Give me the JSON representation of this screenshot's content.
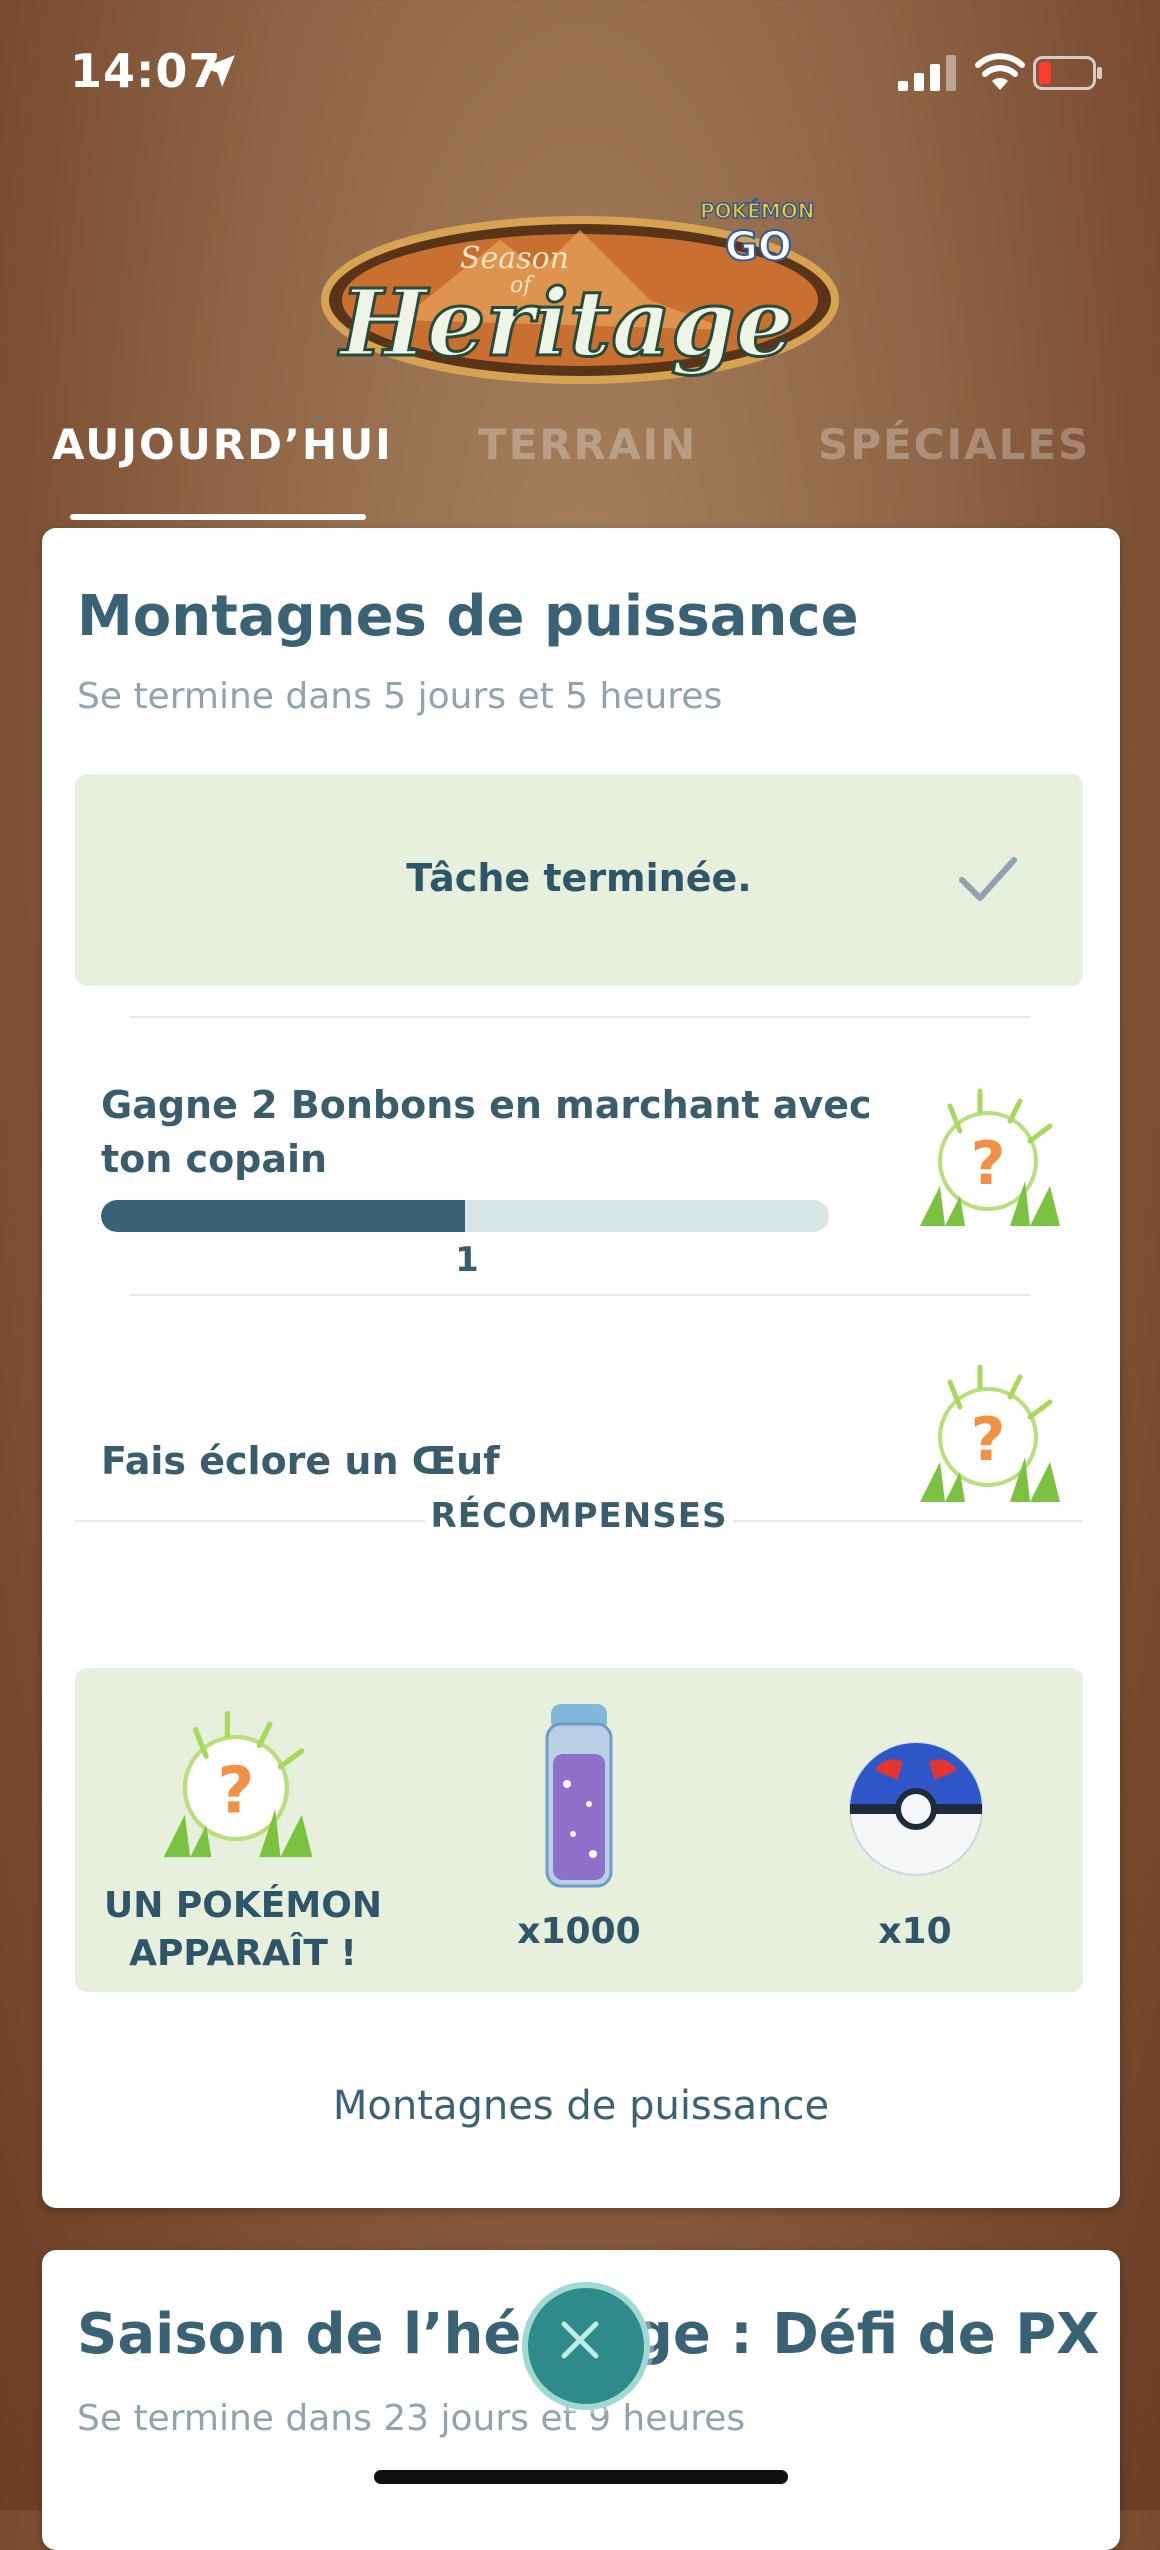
{
  "status_bar": {
    "time": "14:07"
  },
  "logo": {
    "line1": "Season",
    "line2": "of",
    "line3": "Heritage",
    "brand1": "POKÉMON",
    "brand2": "GO"
  },
  "tabs": [
    {
      "label": "AUJOURD’HUI",
      "active": true
    },
    {
      "label": "TERRAIN",
      "active": false
    },
    {
      "label": "SPÉCIALES",
      "active": false
    }
  ],
  "research": {
    "title": "Montagnes de puissance",
    "subtitle": "Se termine dans 5 jours et 5 heures",
    "completed_task": "Tâche terminée.",
    "tasks": [
      {
        "text_line1": "Gagne 2 Bonbons en marchant avec",
        "text_line2": "ton copain",
        "progress": 0.5,
        "progress_label": "1"
      },
      {
        "text_line1": "Fais éclore un Œuf"
      }
    ],
    "rewards_header": "RÉCOMPENSES",
    "rewards": [
      {
        "label_line1": "UN POKÉMON",
        "label_line2": "APPARAÎT !",
        "icon": "mystery-encounter-icon"
      },
      {
        "label_line1": "x1000",
        "icon": "stardust-icon"
      },
      {
        "label_line1": "x10",
        "icon": "great-ball-icon"
      }
    ],
    "footer_link": "Montagnes de puissance"
  },
  "second_card": {
    "title": "Saison de l’héritage : Défi de PX",
    "subtitle": "Se termine dans 23 jours et 9 heures"
  },
  "colors": {
    "accent": "#3a6275",
    "task_bg": "#e6f0dc",
    "close_button": "#2f8a8a"
  }
}
